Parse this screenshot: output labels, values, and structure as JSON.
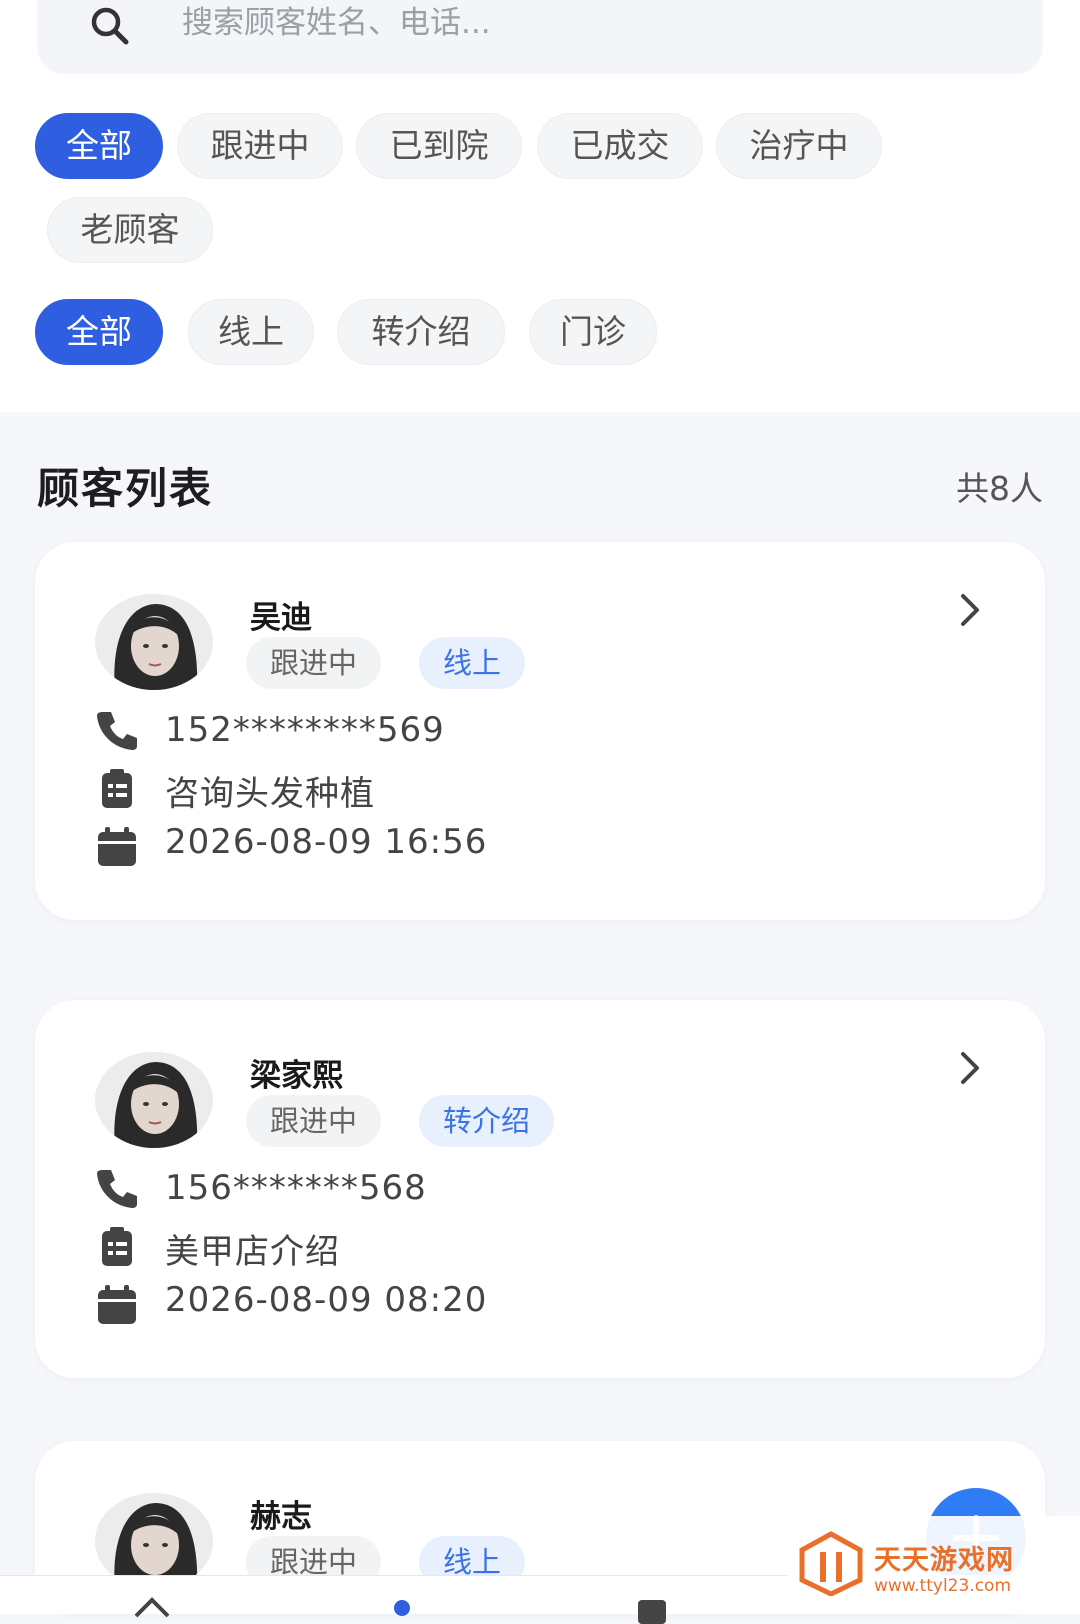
{
  "search": {
    "placeholder": "搜索顾客姓名、电话..."
  },
  "status_filters": [
    {
      "label": "全部",
      "active": true
    },
    {
      "label": "跟进中",
      "active": false
    },
    {
      "label": "已到院",
      "active": false
    },
    {
      "label": "已成交",
      "active": false
    },
    {
      "label": "治疗中",
      "active": false
    },
    {
      "label": "老顾客",
      "active": false
    }
  ],
  "source_filters": [
    {
      "label": "全部",
      "active": true
    },
    {
      "label": "线上",
      "active": false
    },
    {
      "label": "转介绍",
      "active": false
    },
    {
      "label": "门诊",
      "active": false
    }
  ],
  "list_section": {
    "title": "顾客列表",
    "count_label": "共8人"
  },
  "customers": [
    {
      "name": "吴迪",
      "status": "跟进中",
      "source": "线上",
      "phone": "152********569",
      "note": "咨询头发种植",
      "time": "2026-08-09 16:56"
    },
    {
      "name": "梁家熙",
      "status": "跟进中",
      "source": "转介绍",
      "phone": "156*******568",
      "note": "美甲店介绍",
      "time": "2026-08-09 08:20"
    },
    {
      "name": "赫志",
      "status": "跟进中",
      "source": "线上"
    }
  ],
  "watermark": {
    "title": "天天游戏网",
    "url": "www.ttyl23.com"
  },
  "colors": {
    "primary": "#2f5fe0",
    "source_tag_text": "#3b73e6",
    "fab": "#2f7cf6",
    "watermark": "#e8702a"
  }
}
